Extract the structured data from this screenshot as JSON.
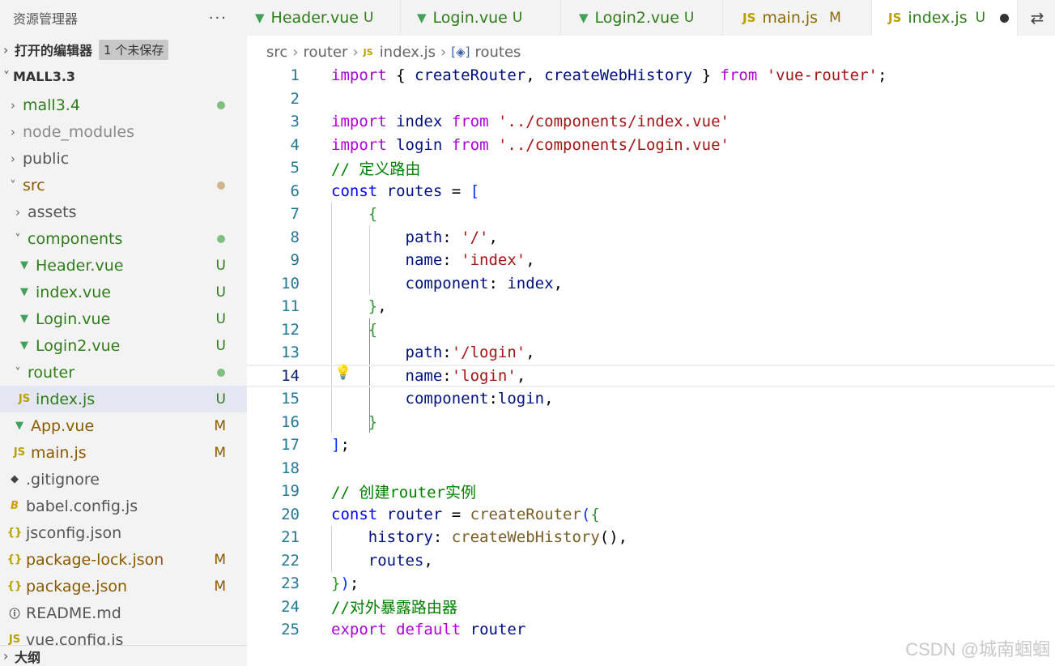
{
  "sidebar": {
    "title": "资源管理器",
    "more_icon": "ellipsis-icon",
    "open_editors_label": "打开的编辑器",
    "unsaved_badge": "1 个未保存",
    "root_label": "MALL3.3",
    "outline_label": "大纲",
    "tree": [
      {
        "label": "mall3.4",
        "kind": "folder",
        "status": "dot-green"
      },
      {
        "label": "node_modules",
        "kind": "folder",
        "status": ""
      },
      {
        "label": "public",
        "kind": "folder",
        "status": ""
      },
      {
        "label": "src",
        "kind": "folder-open",
        "status": "dot-brown"
      },
      {
        "label": "assets",
        "kind": "folder",
        "status": ""
      },
      {
        "label": "components",
        "kind": "folder-open",
        "status": "dot-green"
      },
      {
        "label": "Header.vue",
        "kind": "vue",
        "status": "U"
      },
      {
        "label": "index.vue",
        "kind": "vue",
        "status": "U"
      },
      {
        "label": "Login.vue",
        "kind": "vue",
        "status": "U"
      },
      {
        "label": "Login2.vue",
        "kind": "vue",
        "status": "U"
      },
      {
        "label": "router",
        "kind": "folder-open",
        "status": "dot-green"
      },
      {
        "label": "index.js",
        "kind": "js",
        "status": "U"
      },
      {
        "label": "App.vue",
        "kind": "vue",
        "status": "M"
      },
      {
        "label": "main.js",
        "kind": "js",
        "status": "M"
      },
      {
        "label": ".gitignore",
        "kind": "git",
        "status": ""
      },
      {
        "label": "babel.config.js",
        "kind": "babel",
        "status": ""
      },
      {
        "label": "jsconfig.json",
        "kind": "json",
        "status": ""
      },
      {
        "label": "package-lock.json",
        "kind": "json",
        "status": "M"
      },
      {
        "label": "package.json",
        "kind": "json",
        "status": "M"
      },
      {
        "label": "README.md",
        "kind": "info",
        "status": ""
      },
      {
        "label": "vue.config.js",
        "kind": "js",
        "status": ""
      }
    ]
  },
  "tabs": [
    {
      "label": "Header.vue",
      "icon": "vue-icon",
      "status": "U"
    },
    {
      "label": "Login.vue",
      "icon": "vue-icon",
      "status": "U"
    },
    {
      "label": "Login2.vue",
      "icon": "vue-icon",
      "status": "U"
    },
    {
      "label": "main.js",
      "icon": "js-icon",
      "status": "M"
    },
    {
      "label": "index.js",
      "icon": "js-icon",
      "status": "U"
    }
  ],
  "tab_action_icon": "source-control-compare-icon",
  "breadcrumb": [
    "src",
    "router",
    "index.js",
    "routes"
  ],
  "editor": {
    "lines": [
      [
        [
          "kw",
          "import"
        ],
        [
          "pun",
          " { "
        ],
        [
          "var",
          "createRouter"
        ],
        [
          "pun",
          ", "
        ],
        [
          "var",
          "createWebHistory"
        ],
        [
          "pun",
          " } "
        ],
        [
          "kw",
          "from"
        ],
        [
          "pun",
          " "
        ],
        [
          "str",
          "'vue-router'"
        ],
        [
          "pun",
          ";"
        ]
      ],
      [],
      [
        [
          "kw",
          "import"
        ],
        [
          "pun",
          " "
        ],
        [
          "var",
          "index"
        ],
        [
          "pun",
          " "
        ],
        [
          "kw",
          "from"
        ],
        [
          "pun",
          " "
        ],
        [
          "str",
          "'../components/index.vue'"
        ]
      ],
      [
        [
          "kw",
          "import"
        ],
        [
          "pun",
          " "
        ],
        [
          "var",
          "login"
        ],
        [
          "pun",
          " "
        ],
        [
          "kw",
          "from"
        ],
        [
          "pun",
          " "
        ],
        [
          "str",
          "'../components/Login.vue'"
        ]
      ],
      [
        [
          "cm",
          "// 定义路由"
        ]
      ],
      [
        [
          "kw2",
          "const"
        ],
        [
          "pun",
          " "
        ],
        [
          "var",
          "routes"
        ],
        [
          "pun",
          " = "
        ],
        [
          "br1",
          "["
        ]
      ],
      [
        [
          "pun",
          "    "
        ],
        [
          "br2",
          "{"
        ]
      ],
      [
        [
          "pun",
          "        "
        ],
        [
          "var",
          "path"
        ],
        [
          "pun",
          ": "
        ],
        [
          "str",
          "'/'"
        ],
        [
          "pun",
          ","
        ]
      ],
      [
        [
          "pun",
          "        "
        ],
        [
          "var",
          "name"
        ],
        [
          "pun",
          ": "
        ],
        [
          "str",
          "'index'"
        ],
        [
          "pun",
          ","
        ]
      ],
      [
        [
          "pun",
          "        "
        ],
        [
          "var",
          "component"
        ],
        [
          "pun",
          ": "
        ],
        [
          "var",
          "index"
        ],
        [
          "pun",
          ","
        ]
      ],
      [
        [
          "pun",
          "    "
        ],
        [
          "br2",
          "}"
        ],
        [
          "pun",
          ","
        ]
      ],
      [
        [
          "pun",
          "    "
        ],
        [
          "br2",
          "{"
        ]
      ],
      [
        [
          "pun",
          "        "
        ],
        [
          "var",
          "path"
        ],
        [
          "pun",
          ":"
        ],
        [
          "str",
          "'/login'"
        ],
        [
          "pun",
          ","
        ]
      ],
      [
        [
          "pun",
          "        "
        ],
        [
          "var",
          "name"
        ],
        [
          "pun",
          ":"
        ],
        [
          "str",
          "'login'"
        ],
        [
          "pun",
          ","
        ]
      ],
      [
        [
          "pun",
          "        "
        ],
        [
          "var",
          "component"
        ],
        [
          "pun",
          ":"
        ],
        [
          "var",
          "login"
        ],
        [
          "pun",
          ","
        ]
      ],
      [
        [
          "pun",
          "    "
        ],
        [
          "br2",
          "}"
        ]
      ],
      [
        [
          "br1",
          "]"
        ],
        [
          "pun",
          ";"
        ]
      ],
      [],
      [
        [
          "cm",
          "// 创建router实例"
        ]
      ],
      [
        [
          "kw2",
          "const"
        ],
        [
          "pun",
          " "
        ],
        [
          "var",
          "router"
        ],
        [
          "pun",
          " = "
        ],
        [
          "fn",
          "createRouter"
        ],
        [
          "br1",
          "("
        ],
        [
          "br2",
          "{"
        ]
      ],
      [
        [
          "pun",
          "    "
        ],
        [
          "var",
          "history"
        ],
        [
          "pun",
          ": "
        ],
        [
          "fn",
          "createWebHistory"
        ],
        [
          "pun",
          "(),"
        ]
      ],
      [
        [
          "pun",
          "    "
        ],
        [
          "var",
          "routes"
        ],
        [
          "pun",
          ","
        ]
      ],
      [
        [
          "br2",
          "}"
        ],
        [
          "br1",
          ")"
        ],
        [
          "pun",
          ";"
        ]
      ],
      [
        [
          "cm",
          "//对外暴露路由器"
        ]
      ],
      [
        [
          "kw",
          "export"
        ],
        [
          "pun",
          " "
        ],
        [
          "kw",
          "default"
        ],
        [
          "pun",
          " "
        ],
        [
          "var",
          "router"
        ]
      ]
    ],
    "current_line": 14
  },
  "watermark": "CSDN @城南蝈蝈"
}
